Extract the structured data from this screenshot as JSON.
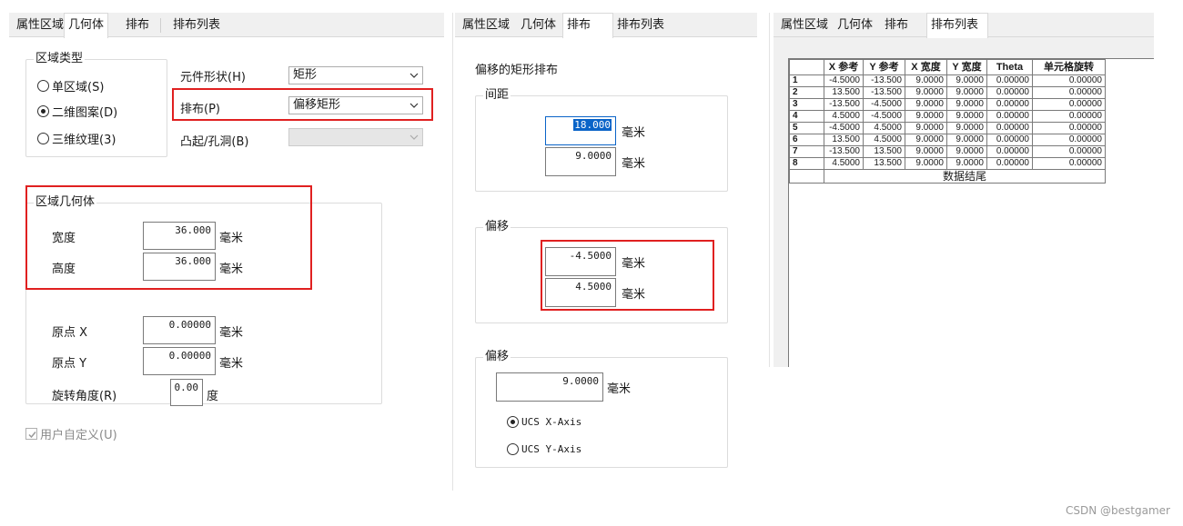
{
  "tabs": [
    "属性区域",
    "几何体",
    "排布",
    "排布列表"
  ],
  "panel1": {
    "region_type": {
      "title": "区域类型",
      "options": [
        "单区域(S)",
        "二维图案(D)",
        "三维纹理(3)"
      ],
      "selected_index": 1
    },
    "element_shape": {
      "label": "元件形状(H)",
      "value": "矩形"
    },
    "layout": {
      "label": "排布(P)",
      "value": "偏移矩形"
    },
    "bump": {
      "label": "凸起/孔洞(B)",
      "value": ""
    },
    "region_geometry": {
      "title": "区域几何体",
      "width": {
        "label": "宽度",
        "value": "36.000",
        "unit": "毫米"
      },
      "height": {
        "label": "高度",
        "value": "36.000",
        "unit": "毫米"
      }
    },
    "origin_x": {
      "label": "原点 X",
      "value": "0.00000",
      "unit": "毫米"
    },
    "origin_y": {
      "label": "原点 Y",
      "value": "0.00000",
      "unit": "毫米"
    },
    "rotation": {
      "label": "旋转角度(R)",
      "value": "0.00",
      "unit": "度"
    },
    "user_defined": {
      "label": "用户自定义(U)",
      "checked": true
    }
  },
  "panel2": {
    "heading": "偏移的矩形排布",
    "spacing": {
      "title": "间距",
      "x": "18.000",
      "y": "9.0000",
      "unit": "毫米"
    },
    "offset1": {
      "title": "偏移",
      "x": "-4.5000",
      "y": "4.5000",
      "unit": "毫米"
    },
    "offset2": {
      "title": "偏移",
      "value": "9.0000",
      "unit": "毫米",
      "options": [
        "UCS X-Axis",
        "UCS Y-Axis"
      ],
      "selected_index": 0
    }
  },
  "panel3": {
    "columns": [
      "",
      "X 参考",
      "Y 参考",
      "X 宽度",
      "Y 宽度",
      "Theta",
      "单元格旋转"
    ],
    "rows": [
      [
        "1",
        "-4.5000",
        "-13.500",
        "9.0000",
        "9.0000",
        "0.00000",
        "0.00000"
      ],
      [
        "2",
        "13.500",
        "-13.500",
        "9.0000",
        "9.0000",
        "0.00000",
        "0.00000"
      ],
      [
        "3",
        "-13.500",
        "-4.5000",
        "9.0000",
        "9.0000",
        "0.00000",
        "0.00000"
      ],
      [
        "4",
        "4.5000",
        "-4.5000",
        "9.0000",
        "9.0000",
        "0.00000",
        "0.00000"
      ],
      [
        "5",
        "-4.5000",
        "4.5000",
        "9.0000",
        "9.0000",
        "0.00000",
        "0.00000"
      ],
      [
        "6",
        "13.500",
        "4.5000",
        "9.0000",
        "9.0000",
        "0.00000",
        "0.00000"
      ],
      [
        "7",
        "-13.500",
        "13.500",
        "9.0000",
        "9.0000",
        "0.00000",
        "0.00000"
      ],
      [
        "8",
        "4.5000",
        "13.500",
        "9.0000",
        "9.0000",
        "0.00000",
        "0.00000"
      ]
    ],
    "footer": "数据结尾"
  },
  "watermark": "CSDN @bestgamer",
  "colors": {
    "highlight": "#e02020",
    "selection": "#0a64c8"
  }
}
